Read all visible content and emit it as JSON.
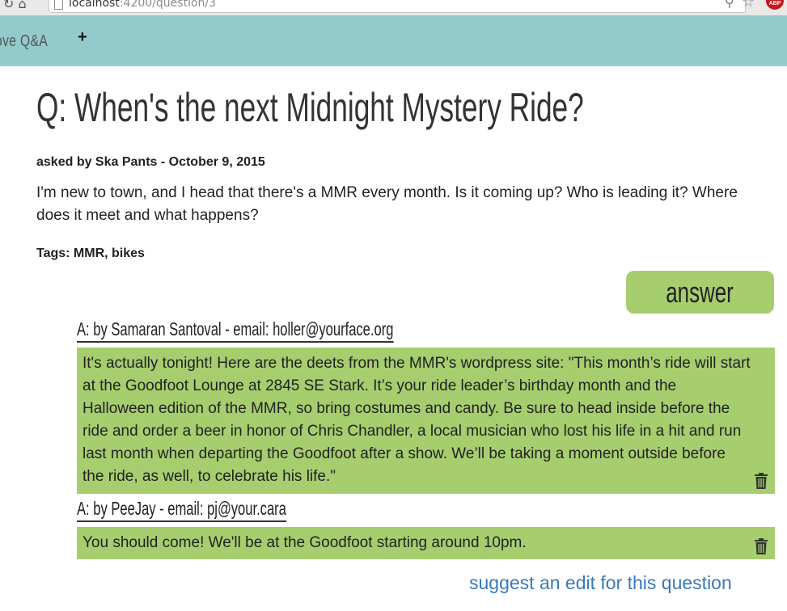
{
  "browser": {
    "url_host": "localhost",
    "url_path": ":4200/question/3",
    "extension_badge": "ABP"
  },
  "header": {
    "brand": "ove Q&A",
    "add_label": "+"
  },
  "question": {
    "title": "Q: When's the next Midnight Mystery Ride?",
    "asked_by": "asked by Ska Pants - October 9, 2015",
    "body": "I'm new to town, and I head that there's a MMR every month. Is it coming up? Who is leading it? Where does it meet and what happens?",
    "tags": "Tags: MMR, bikes"
  },
  "answer_button": "answer",
  "answers": [
    {
      "heading": "A: by Samaran Santoval - email: holler@yourface.org",
      "body": "It's actually tonight! Here are the deets from the MMR's wordpress site: \"This month’s ride will start at the Goodfoot Lounge at 2845 SE Stark. It’s your ride leader’s birthday month and the Halloween edition of the MMR, so bring costumes and candy. Be sure to head inside before the ride and order a beer in honor of Chris Chandler, a local musician who lost his life in a hit and run last month when departing the Goodfoot after a show. We’ll be taking a moment outside before the ride, as well, to celebrate his life.\""
    },
    {
      "heading": "A: by PeeJay - email: pj@your.cara",
      "body": "You should come! We'll be at the Goodfoot starting around 10pm."
    }
  ],
  "edit_link": "suggest an edit for this question",
  "colors": {
    "header_bg": "#93cbcc",
    "accent_green": "#a6ce6f",
    "link": "#3a7ab8"
  }
}
